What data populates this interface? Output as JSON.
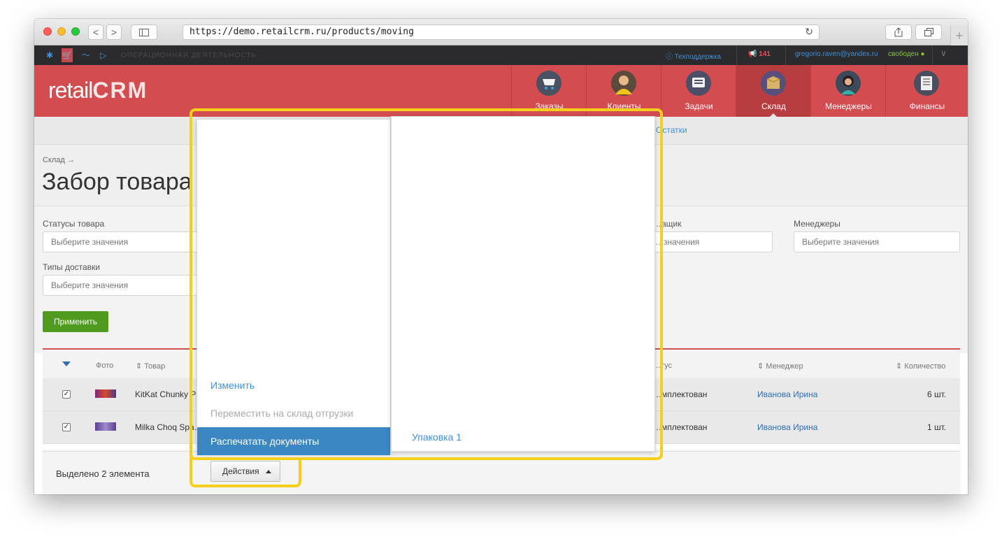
{
  "browser": {
    "url": "https://demo.retailcrm.ru/products/moving",
    "back": "<",
    "forward": ">",
    "new_tab": "+"
  },
  "topbar": {
    "section_title": "ОПЕРАЦИОННАЯ ДЕЯТЕЛЬНОСТЬ",
    "support": "Техподдержка",
    "notifications": "141",
    "user_email": "gregorio.raven@yandex.ru",
    "user_status": "свободен"
  },
  "header": {
    "logo_text": "retail",
    "logo_crm": "CRM",
    "nav": [
      {
        "label": "Заказы",
        "icon": "cart-icon"
      },
      {
        "label": "Клиенты",
        "icon": "client-icon"
      },
      {
        "label": "Задачи",
        "icon": "tasks-icon"
      },
      {
        "label": "Склад",
        "icon": "warehouse-box-icon",
        "active": true
      },
      {
        "label": "Менеджеры",
        "icon": "manager-icon"
      },
      {
        "label": "Финансы",
        "icon": "finance-icon"
      }
    ]
  },
  "subnav": {
    "visible_link": "Остатки"
  },
  "page": {
    "breadcrumb": "Склад →",
    "title": "Забор товара"
  },
  "filters": {
    "statuses_label": "Статусы товара",
    "statuses_placeholder": "Выберите значения",
    "supplier_label": "…ащик",
    "supplier_placeholder": "…значения",
    "managers_label": "Менеджеры",
    "managers_placeholder": "Выберите значения",
    "delivery_label": "Типы доставки",
    "delivery_placeholder": "Выберите значения",
    "apply": "Применить"
  },
  "table": {
    "headers": {
      "photo": "Фото",
      "product": "Товар",
      "status": "…тус",
      "manager": "Менеджер",
      "quantity": "Количество"
    },
    "rows": [
      {
        "product": "KitKat Chunky P…",
        "status": "…мплектован",
        "manager": "Иванова Ирина",
        "qty": "6 шт.",
        "checked": true
      },
      {
        "product": "Milka Choq Spa…",
        "status": "…мплектован",
        "manager": "Иванова Ирина",
        "qty": "1 шт.",
        "checked": true
      }
    ]
  },
  "selection": {
    "text": "Выделено 2 элемента",
    "actions": "Действия"
  },
  "menu": {
    "items": [
      {
        "label": "Изменить",
        "state": "link"
      },
      {
        "label": "Переместить на склад отгрузки",
        "state": "disabled"
      },
      {
        "label": "Распечатать документы",
        "state": "selected"
      }
    ],
    "submenu": [
      "Упаковка 1"
    ]
  },
  "colors": {
    "brand_red": "#d24c50",
    "link_blue": "#3f8fd6",
    "highlight": "#f6cf1b",
    "apply_green": "#4f9a1f"
  }
}
